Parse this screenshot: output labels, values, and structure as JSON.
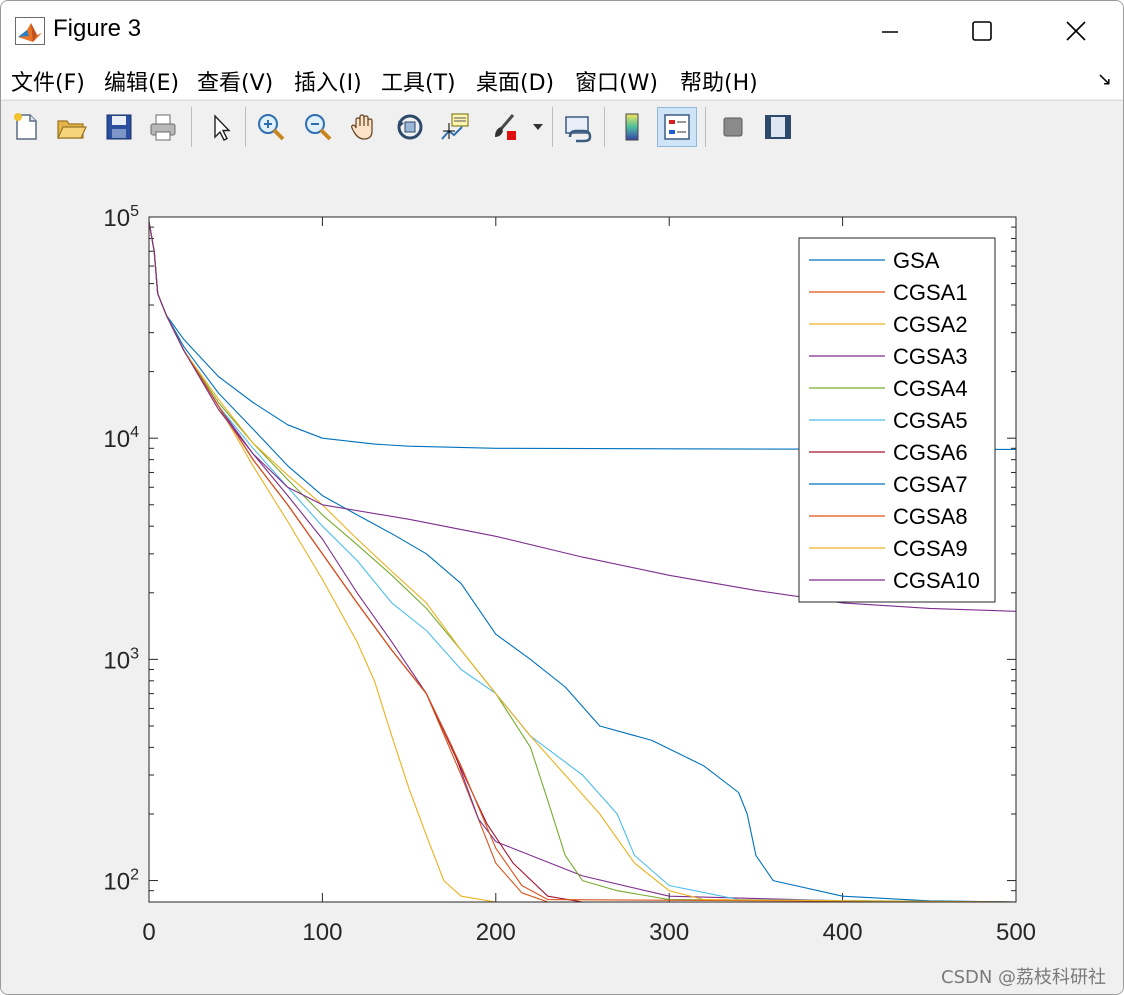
{
  "window": {
    "title": "Figure 3"
  },
  "menu": {
    "items": [
      {
        "label": "文件(F)"
      },
      {
        "label": "编辑(E)"
      },
      {
        "label": "查看(V)"
      },
      {
        "label": "插入(I)"
      },
      {
        "label": "工具(T)"
      },
      {
        "label": "桌面(D)"
      },
      {
        "label": "窗口(W)"
      },
      {
        "label": "帮助(H)"
      }
    ],
    "dock_glyph": "↘"
  },
  "toolbar": {
    "icons": [
      "new-figure-icon",
      "open-file-icon",
      "save-icon",
      "print-icon",
      "select-arrow-icon",
      "zoom-in-icon",
      "zoom-out-icon",
      "pan-hand-icon",
      "rotate-3d-icon",
      "data-cursor-icon",
      "brush-icon",
      "brush-dropdown-icon",
      "link-plot-icon",
      "colorbar-icon",
      "legend-icon",
      "hide-plot-tools-icon",
      "show-plot-tools-icon"
    ],
    "active": "legend-icon"
  },
  "watermark": "CSDN @荔枝科研社",
  "chart_data": {
    "type": "line",
    "title": "",
    "xlabel": "",
    "ylabel": "",
    "xlim": [
      0,
      500
    ],
    "ylim": [
      80,
      100000
    ],
    "yscale": "log",
    "grid": false,
    "legend_position": "top-right",
    "x_ticks": [
      0,
      100,
      200,
      300,
      400,
      500
    ],
    "x_tick_labels": [
      "0",
      "100",
      "200",
      "300",
      "400",
      "500"
    ],
    "y_ticks": [
      100,
      1000,
      10000,
      100000
    ],
    "y_tick_labels": [
      {
        "base": "10",
        "exp": "2"
      },
      {
        "base": "10",
        "exp": "3"
      },
      {
        "base": "10",
        "exp": "4"
      },
      {
        "base": "10",
        "exp": "5"
      }
    ],
    "series": [
      {
        "name": "GSA",
        "color": "#0072BD",
        "points": [
          [
            0,
            95000
          ],
          [
            3,
            70000
          ],
          [
            5,
            45000
          ],
          [
            10,
            36000
          ],
          [
            20,
            28000
          ],
          [
            40,
            19000
          ],
          [
            60,
            14500
          ],
          [
            80,
            11500
          ],
          [
            100,
            10000
          ],
          [
            130,
            9400
          ],
          [
            150,
            9200
          ],
          [
            200,
            9000
          ],
          [
            300,
            8950
          ],
          [
            400,
            8920
          ],
          [
            500,
            8900
          ]
        ]
      },
      {
        "name": "CGSA1",
        "color": "#D95319",
        "points": [
          [
            0,
            95000
          ],
          [
            3,
            70000
          ],
          [
            5,
            45000
          ],
          [
            10,
            36000
          ],
          [
            20,
            25000
          ],
          [
            40,
            14000
          ],
          [
            60,
            8000
          ],
          [
            80,
            5000
          ],
          [
            100,
            3000
          ],
          [
            120,
            1800
          ],
          [
            140,
            1100
          ],
          [
            160,
            700
          ],
          [
            180,
            300
          ],
          [
            200,
            120
          ],
          [
            215,
            88
          ],
          [
            230,
            80
          ],
          [
            500,
            80
          ]
        ]
      },
      {
        "name": "CGSA2",
        "color": "#EDB120",
        "points": [
          [
            0,
            95000
          ],
          [
            3,
            70000
          ],
          [
            5,
            45000
          ],
          [
            10,
            36000
          ],
          [
            20,
            25000
          ],
          [
            40,
            14000
          ],
          [
            60,
            7500
          ],
          [
            80,
            4200
          ],
          [
            100,
            2300
          ],
          [
            120,
            1200
          ],
          [
            130,
            800
          ],
          [
            140,
            450
          ],
          [
            150,
            260
          ],
          [
            160,
            160
          ],
          [
            170,
            100
          ],
          [
            180,
            85
          ],
          [
            200,
            80
          ],
          [
            500,
            80
          ]
        ]
      },
      {
        "name": "CGSA3",
        "color": "#7E2F8E",
        "points": [
          [
            0,
            95000
          ],
          [
            3,
            70000
          ],
          [
            5,
            45000
          ],
          [
            10,
            36000
          ],
          [
            20,
            25000
          ],
          [
            40,
            14000
          ],
          [
            60,
            8500
          ],
          [
            80,
            5500
          ],
          [
            100,
            3500
          ],
          [
            120,
            2000
          ],
          [
            140,
            1200
          ],
          [
            160,
            700
          ],
          [
            175,
            400
          ],
          [
            190,
            190
          ],
          [
            200,
            150
          ],
          [
            250,
            105
          ],
          [
            300,
            85
          ],
          [
            400,
            81
          ],
          [
            500,
            80
          ]
        ]
      },
      {
        "name": "CGSA4",
        "color": "#77AC30",
        "points": [
          [
            0,
            95000
          ],
          [
            3,
            70000
          ],
          [
            5,
            45000
          ],
          [
            10,
            36000
          ],
          [
            20,
            25000
          ],
          [
            40,
            14500
          ],
          [
            60,
            9500
          ],
          [
            80,
            6500
          ],
          [
            100,
            4500
          ],
          [
            120,
            3300
          ],
          [
            140,
            2400
          ],
          [
            160,
            1700
          ],
          [
            180,
            1100
          ],
          [
            200,
            700
          ],
          [
            220,
            400
          ],
          [
            230,
            230
          ],
          [
            240,
            130
          ],
          [
            250,
            100
          ],
          [
            270,
            90
          ],
          [
            300,
            82
          ],
          [
            500,
            80
          ]
        ]
      },
      {
        "name": "CGSA5",
        "color": "#4DBEEE",
        "points": [
          [
            0,
            95000
          ],
          [
            3,
            70000
          ],
          [
            5,
            45000
          ],
          [
            10,
            36000
          ],
          [
            20,
            25000
          ],
          [
            40,
            14000
          ],
          [
            60,
            9000
          ],
          [
            80,
            6000
          ],
          [
            100,
            4000
          ],
          [
            120,
            2800
          ],
          [
            140,
            1800
          ],
          [
            160,
            1350
          ],
          [
            180,
            900
          ],
          [
            200,
            700
          ],
          [
            220,
            450
          ],
          [
            250,
            300
          ],
          [
            270,
            200
          ],
          [
            280,
            130
          ],
          [
            300,
            95
          ],
          [
            340,
            82
          ],
          [
            500,
            80
          ]
        ]
      },
      {
        "name": "CGSA6",
        "color": "#A2142F",
        "points": [
          [
            0,
            95000
          ],
          [
            3,
            70000
          ],
          [
            5,
            45000
          ],
          [
            10,
            36000
          ],
          [
            20,
            25000
          ],
          [
            40,
            14000
          ],
          [
            60,
            8000
          ],
          [
            80,
            5000
          ],
          [
            100,
            3000
          ],
          [
            120,
            1800
          ],
          [
            140,
            1100
          ],
          [
            160,
            700
          ],
          [
            180,
            320
          ],
          [
            195,
            180
          ],
          [
            210,
            120
          ],
          [
            230,
            85
          ],
          [
            250,
            80
          ],
          [
            500,
            80
          ]
        ]
      },
      {
        "name": "CGSA7",
        "color": "#0072BD",
        "points": [
          [
            0,
            95000
          ],
          [
            3,
            70000
          ],
          [
            5,
            45000
          ],
          [
            10,
            36000
          ],
          [
            20,
            26000
          ],
          [
            40,
            16000
          ],
          [
            60,
            11000
          ],
          [
            80,
            7500
          ],
          [
            100,
            5500
          ],
          [
            120,
            4500
          ],
          [
            140,
            3700
          ],
          [
            160,
            3000
          ],
          [
            180,
            2200
          ],
          [
            200,
            1300
          ],
          [
            220,
            1000
          ],
          [
            240,
            750
          ],
          [
            260,
            500
          ],
          [
            290,
            430
          ],
          [
            320,
            330
          ],
          [
            340,
            250
          ],
          [
            345,
            200
          ],
          [
            350,
            130
          ],
          [
            360,
            100
          ],
          [
            400,
            85
          ],
          [
            450,
            81
          ],
          [
            500,
            80
          ]
        ]
      },
      {
        "name": "CGSA8",
        "color": "#D95319",
        "points": [
          [
            0,
            95000
          ],
          [
            3,
            70000
          ],
          [
            5,
            45000
          ],
          [
            10,
            36000
          ],
          [
            20,
            25000
          ],
          [
            40,
            14000
          ],
          [
            60,
            8000
          ],
          [
            80,
            5000
          ],
          [
            100,
            3000
          ],
          [
            120,
            1800
          ],
          [
            140,
            1100
          ],
          [
            160,
            700
          ],
          [
            180,
            330
          ],
          [
            200,
            140
          ],
          [
            215,
            95
          ],
          [
            230,
            82
          ],
          [
            500,
            80
          ]
        ]
      },
      {
        "name": "CGSA9",
        "color": "#EDB120",
        "points": [
          [
            0,
            95000
          ],
          [
            3,
            70000
          ],
          [
            5,
            45000
          ],
          [
            10,
            36000
          ],
          [
            20,
            25000
          ],
          [
            40,
            15000
          ],
          [
            60,
            9500
          ],
          [
            80,
            6800
          ],
          [
            100,
            5000
          ],
          [
            120,
            3500
          ],
          [
            140,
            2500
          ],
          [
            160,
            1800
          ],
          [
            180,
            1100
          ],
          [
            200,
            700
          ],
          [
            220,
            450
          ],
          [
            240,
            300
          ],
          [
            260,
            200
          ],
          [
            280,
            120
          ],
          [
            300,
            90
          ],
          [
            320,
            82
          ],
          [
            500,
            80
          ]
        ]
      },
      {
        "name": "CGSA10",
        "color": "#7E2F8E",
        "points": [
          [
            0,
            95000
          ],
          [
            3,
            70000
          ],
          [
            5,
            45000
          ],
          [
            10,
            36000
          ],
          [
            20,
            25000
          ],
          [
            40,
            13500
          ],
          [
            60,
            8500
          ],
          [
            80,
            6000
          ],
          [
            100,
            5000
          ],
          [
            150,
            4300
          ],
          [
            200,
            3600
          ],
          [
            250,
            2900
          ],
          [
            300,
            2400
          ],
          [
            350,
            2050
          ],
          [
            400,
            1800
          ],
          [
            450,
            1700
          ],
          [
            500,
            1650
          ]
        ]
      }
    ]
  }
}
